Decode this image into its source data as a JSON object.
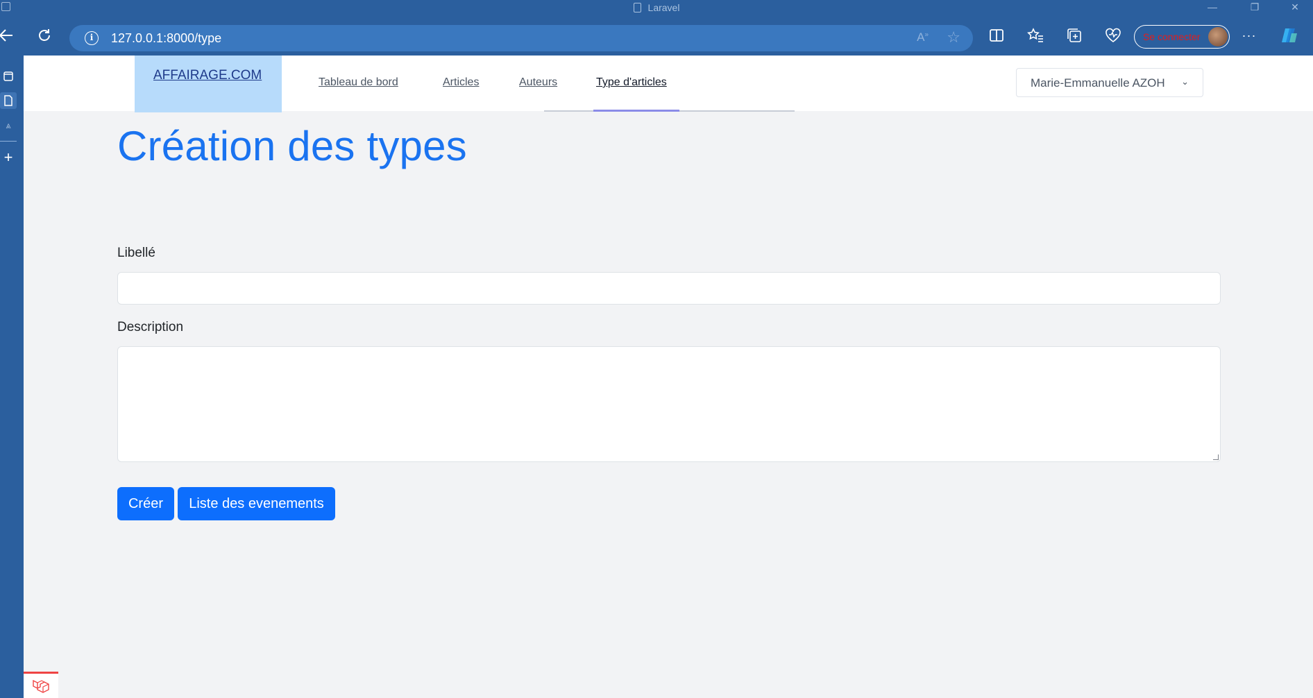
{
  "browser": {
    "window_title": "Laravel",
    "url": "127.0.0.1:8000/type",
    "read_aloud_label": "A",
    "sign_in_label": "Se connecter",
    "colors": {
      "chrome": "#2b5f9e",
      "address_bar": "#3a78bf",
      "sign_in_text": "#e21d1d"
    },
    "toolbar_icons": [
      "back-icon",
      "refresh-icon",
      "info-icon",
      "read-aloud-icon",
      "favorite-star-icon",
      "split-screen-icon",
      "favorites-icon",
      "collections-icon",
      "browser-essentials-icon",
      "more-icon",
      "copilot-icon"
    ],
    "sidebar_icons": [
      "tab-icon",
      "page-icon",
      "translate-icon",
      "add-icon"
    ]
  },
  "nav": {
    "logo": "AFFAIRAGE.COM",
    "links": [
      {
        "label": "Tableau de bord",
        "active": false
      },
      {
        "label": "Articles",
        "active": false
      },
      {
        "label": "Auteurs",
        "active": false
      },
      {
        "label": "Type d'articles",
        "active": true
      }
    ],
    "user_name": "Marie-Emmanuelle AZOH",
    "user_chevron": "⌄",
    "colors": {
      "logo_bg": "#b7dbfb",
      "active_underline": "#8b8ce8"
    }
  },
  "form": {
    "title": "Création des types",
    "fields": {
      "libelle_label": "Libellé",
      "libelle_value": "",
      "description_label": "Description",
      "description_value": ""
    },
    "buttons": {
      "create": "Créer",
      "list": "Liste des evenements"
    },
    "colors": {
      "title": "#1a73f0",
      "button": "#0d6efd"
    }
  }
}
